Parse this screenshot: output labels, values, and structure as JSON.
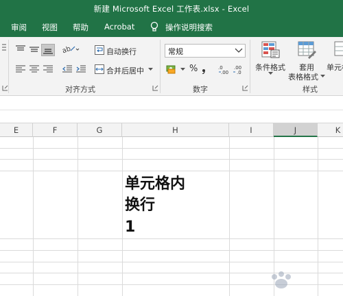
{
  "window": {
    "title": "新建 Microsoft Excel 工作表.xlsx  -  Excel"
  },
  "tabs": [
    {
      "label": "审阅"
    },
    {
      "label": "视图"
    },
    {
      "label": "帮助"
    },
    {
      "label": "Acrobat"
    },
    {
      "label": "操作说明搜索"
    }
  ],
  "ribbon": {
    "alignment": {
      "group_label": "对齐方式",
      "wrap_text_label": "自动换行",
      "merge_center_label": "合并后居中"
    },
    "number": {
      "group_label": "数字",
      "format_value": "常规",
      "percent_symbol": "%"
    },
    "styles": {
      "group_label": "样式",
      "conditional_label": "条件格式",
      "table_label_1": "套用",
      "table_label_2": "表格格式",
      "cell_styles_label": "单元格"
    }
  },
  "grid": {
    "columns": [
      {
        "label": "E"
      },
      {
        "label": "F"
      },
      {
        "label": "G"
      },
      {
        "label": "H"
      },
      {
        "label": "I"
      },
      {
        "label": "J"
      },
      {
        "label": "K"
      }
    ],
    "selected_column": "J",
    "cell_lines": [
      "单元格内",
      "换行",
      "1"
    ]
  },
  "colors": {
    "brand": "#217346",
    "ribbon_bg": "#f3f3f3",
    "gridline": "#dadada"
  }
}
